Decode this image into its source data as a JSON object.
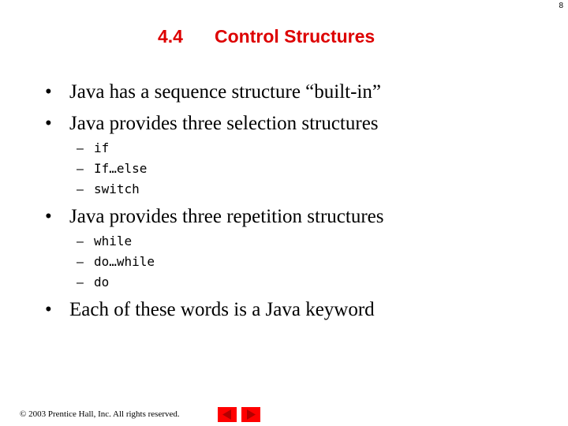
{
  "page_number": "8",
  "title": {
    "section": "4.4",
    "text": "Control Structures"
  },
  "bullets": [
    {
      "text": "Java has a sequence structure “built-in”"
    },
    {
      "text": "Java provides three selection structures",
      "subitems": [
        "if",
        "If…else",
        "switch"
      ]
    },
    {
      "text": "Java provides three repetition structures",
      "subitems": [
        "while",
        "do…while",
        "do"
      ]
    },
    {
      "text": "Each of these words is a Java keyword"
    }
  ],
  "bullet_glyph": "•",
  "dash_glyph": "–",
  "footer": {
    "copyright": "© 2003 Prentice Hall, Inc.  All rights reserved."
  },
  "nav": {
    "prev_icon": "triangle-left-icon",
    "next_icon": "triangle-right-icon"
  },
  "colors": {
    "title": "#dd0000",
    "nav_button": "#ff0000",
    "nav_arrow": "#b30000"
  }
}
